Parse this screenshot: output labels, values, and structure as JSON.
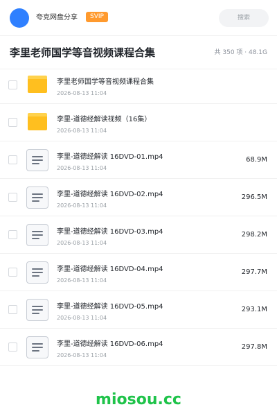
{
  "header": {
    "user_name": "夸克网盘分享",
    "vip_badge": "SVIP",
    "search_placeholder": "搜索"
  },
  "title_row": {
    "title": "李里老师国学等音视频课程合集",
    "summary": "共 350 项 · 48.1G"
  },
  "files": [
    {
      "type": "folder",
      "name": "李里老师国学等音视频课程合集",
      "date": "2026-08-13 11:04",
      "size": ""
    },
    {
      "type": "folder",
      "name": "李里-道德经解读视频（16集）",
      "date": "2026-08-13 11:04",
      "size": ""
    },
    {
      "type": "file",
      "name": "李里-道德经解读 16DVD-01.mp4",
      "date": "2026-08-13 11:04",
      "size": "68.9M"
    },
    {
      "type": "file",
      "name": "李里-道德经解读 16DVD-02.mp4",
      "date": "2026-08-13 11:04",
      "size": "296.5M"
    },
    {
      "type": "file",
      "name": "李里-道德经解读 16DVD-03.mp4",
      "date": "2026-08-13 11:04",
      "size": "298.2M"
    },
    {
      "type": "file",
      "name": "李里-道德经解读 16DVD-04.mp4",
      "date": "2026-08-13 11:04",
      "size": "297.7M"
    },
    {
      "type": "file",
      "name": "李里-道德经解读 16DVD-05.mp4",
      "date": "2026-08-13 11:04",
      "size": "293.1M"
    },
    {
      "type": "file",
      "name": "李里-道德经解读 16DVD-06.mp4",
      "date": "2026-08-13 11:04",
      "size": "297.8M"
    }
  ],
  "watermark": "miosou.cc",
  "colors": {
    "avatar": "#2f80ff",
    "vip_badge": "#ff9a2e",
    "folder": "#ffbf1f",
    "watermark": "#1fc34a"
  }
}
